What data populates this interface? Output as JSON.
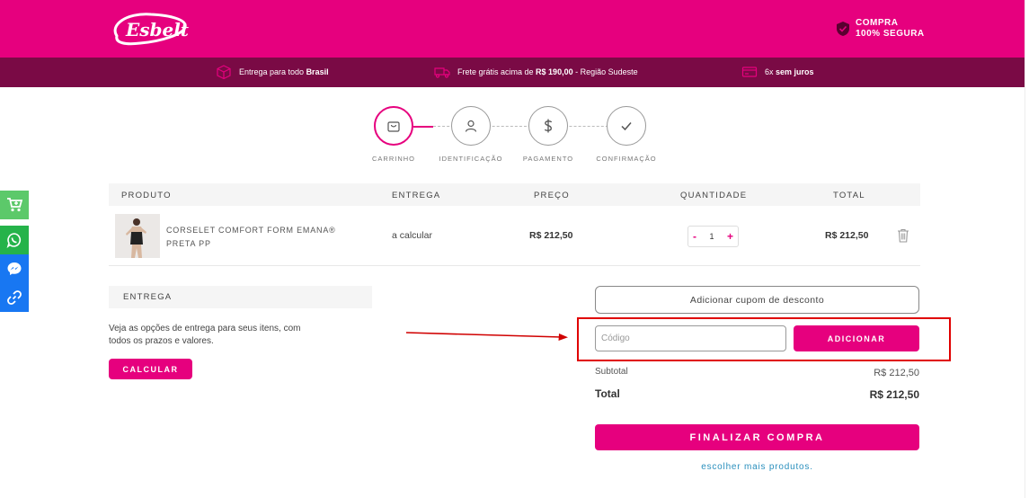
{
  "header": {
    "logo_text": "Esbelt",
    "secure_line1": "COMPRA",
    "secure_line2": "100% SEGURA"
  },
  "benefits": [
    {
      "icon": "box-icon",
      "text": "Entrega para todo ",
      "bold": "Brasil",
      "suffix": ""
    },
    {
      "icon": "truck-icon",
      "text": "Frete grátis acima de ",
      "bold": "R$ 190,00",
      "suffix": " - Região Sudeste"
    },
    {
      "icon": "credit-card-icon",
      "text": "6x ",
      "bold": "sem juros",
      "suffix": ""
    }
  ],
  "social": [
    {
      "icon": "cart-icon",
      "color": "#5cc96a"
    },
    {
      "icon": "whatsapp-icon",
      "color": "#25b34a"
    },
    {
      "icon": "messenger-icon",
      "color": "#1877f2"
    },
    {
      "icon": "link-icon",
      "color": "#1877f2"
    }
  ],
  "steps": [
    {
      "label": "CARRINHO",
      "icon": "bag-icon",
      "active": true
    },
    {
      "label": "IDENTIFICAÇÃO",
      "icon": "user-icon",
      "active": false
    },
    {
      "label": "PAGAMENTO",
      "icon": "dollar-icon",
      "active": false
    },
    {
      "label": "CONFIRMAÇÃO",
      "icon": "check-icon",
      "active": false
    }
  ],
  "table": {
    "headers": {
      "product": "PRODUTO",
      "delivery": "ENTREGA",
      "price": "PREÇO",
      "quantity": "QUANTIDADE",
      "total": "TOTAL"
    },
    "item": {
      "name": "CORSELET COMFORT FORM EMANA® PRETA PP",
      "delivery": "a calcular",
      "price": "R$ 212,50",
      "quantity": "1",
      "minus": "-",
      "plus": "+",
      "total": "R$ 212,50"
    }
  },
  "delivery": {
    "title": "ENTREGA",
    "description": "Veja as opções de entrega para seus itens, com todos os prazos e valores.",
    "button": "CALCULAR"
  },
  "coupon": {
    "toggle": "Adicionar cupom de desconto",
    "placeholder": "Código",
    "button": "ADICIONAR"
  },
  "summary": {
    "subtotal_label": "Subtotal",
    "subtotal_value": "R$ 212,50",
    "total_label": "Total",
    "total_value": "R$ 212,50",
    "finalize": "FINALIZAR COMPRA",
    "more": "escolher mais produtos."
  },
  "colors": {
    "brand": "#e6007e",
    "bar": "#7a0a45",
    "highlight": "#e00000"
  }
}
